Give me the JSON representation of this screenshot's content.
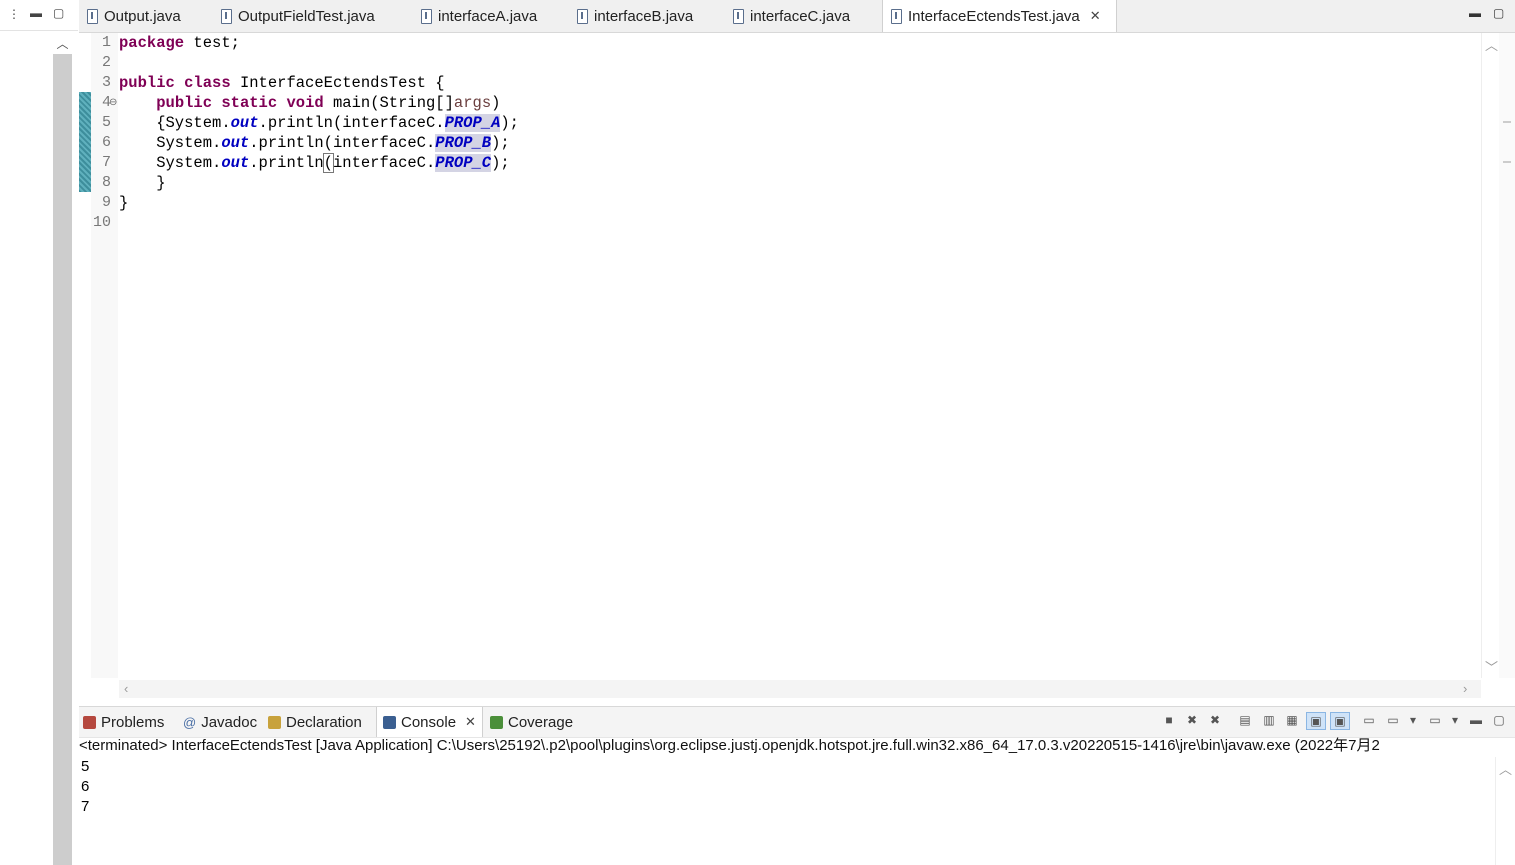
{
  "editor": {
    "tabs": [
      {
        "label": "Output.java"
      },
      {
        "label": "OutputFieldTest.java"
      },
      {
        "label": "interfaceA.java"
      },
      {
        "label": "interfaceB.java"
      },
      {
        "label": "interfaceC.java"
      },
      {
        "label": "InterfaceEctendsTest.java",
        "active": true
      }
    ],
    "line_numbers": [
      "1",
      "2",
      "3",
      "4",
      "5",
      "6",
      "7",
      "8",
      "9",
      "10"
    ],
    "code": {
      "l1_kw": "package",
      "l1_rest": " test;",
      "l3_kw1": "public",
      "l3_kw2": "class",
      "l3_rest": " InterfaceEctendsTest {",
      "l4_indent": "    ",
      "l4_kw1": "public",
      "l4_kw2": "static",
      "l4_kw3": "void",
      "l4_rest": " main(String[]",
      "l4_param": "args",
      "l4_end": ")",
      "l5_a": "    {System.",
      "l5_out": "out",
      "l5_b": ".println(interfaceC.",
      "l5_field": "PROP_A",
      "l5_end": ");",
      "l6_a": "    System.",
      "l6_out": "out",
      "l6_b": ".println(interfaceC.",
      "l6_field": "PROP_B",
      "l6_end": ");",
      "l7_a": "    System.",
      "l7_out": "out",
      "l7_b": ".println",
      "l7_paren": "(",
      "l7_c": "interfaceC.",
      "l7_field": "PROP_C",
      "l7_end": ");",
      "l8": "    }",
      "l9": "}"
    }
  },
  "panel": {
    "tabs": [
      {
        "label": "Problems",
        "color": "#b5483e"
      },
      {
        "label": "Javadoc",
        "color": "#4a6fa5"
      },
      {
        "label": "Declaration",
        "color": "#c8a23c"
      },
      {
        "label": "Console",
        "color": "#3b5f91",
        "active": true
      },
      {
        "label": "Coverage",
        "color": "#4b8f3a"
      }
    ],
    "console_status": "<terminated> InterfaceEctendsTest [Java Application] C:\\Users\\25192\\.p2\\pool\\plugins\\org.eclipse.justj.openjdk.hotspot.jre.full.win32.x86_64_17.0.3.v20220515-1416\\jre\\bin\\javaw.exe  (2022年7月2",
    "output": [
      "5",
      "6",
      "7"
    ]
  }
}
